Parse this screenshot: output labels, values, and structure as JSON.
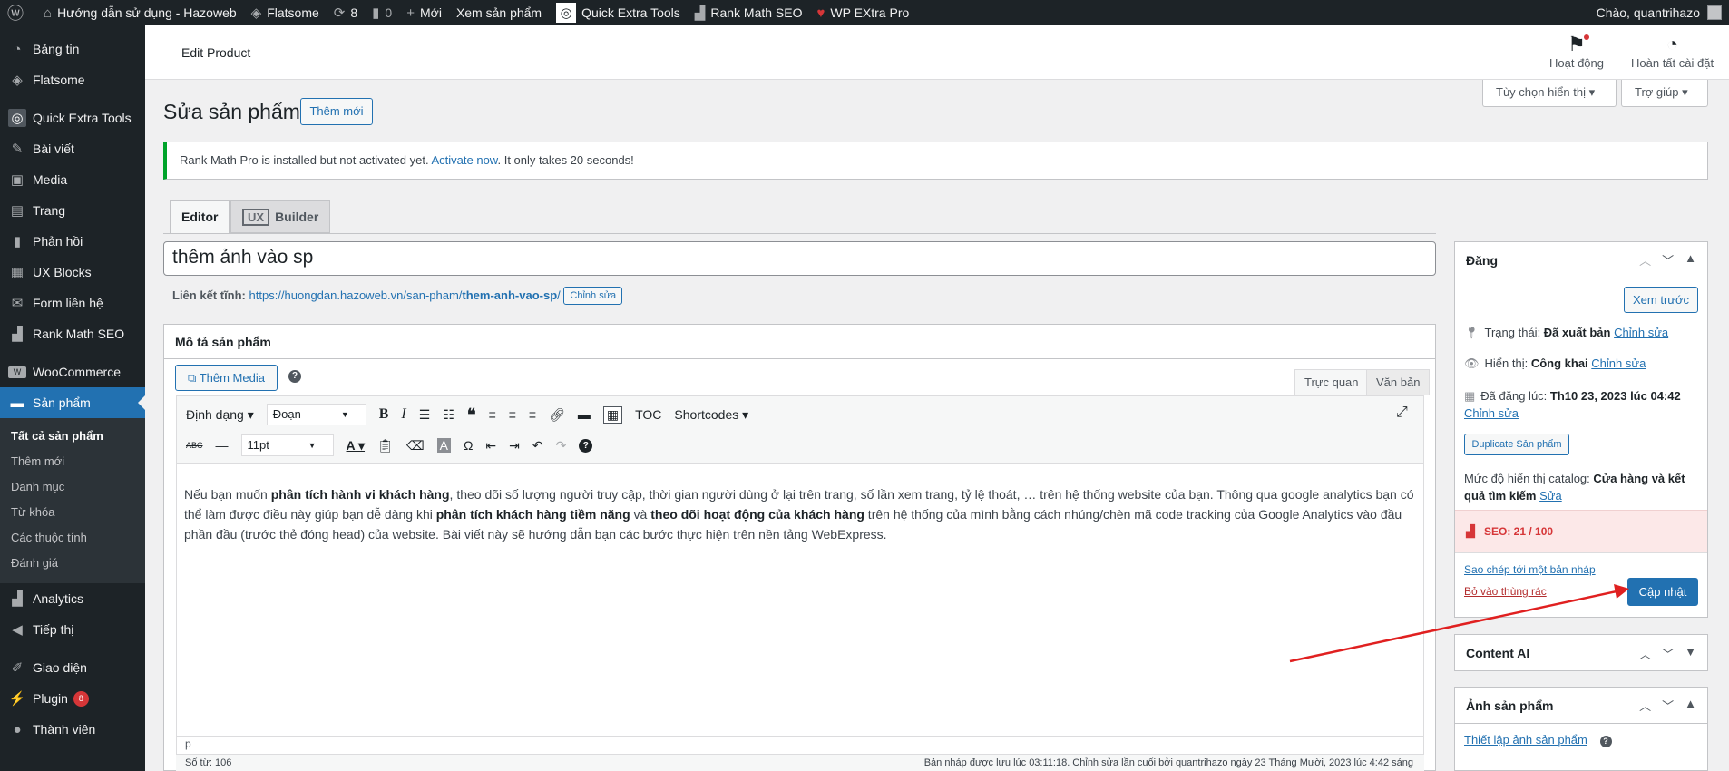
{
  "adminbar": {
    "site_name": "Hướng dẫn sử dụng - Hazoweb",
    "flatsome": "Flatsome",
    "updates": "8",
    "comments": "0",
    "new": "Mới",
    "view_product": "Xem sản phẩm",
    "quick_extra_tools": "Quick Extra Tools",
    "rank_math": "Rank Math SEO",
    "wp_extra": "WP EXtra Pro",
    "greeting": "Chào, quantrihazo"
  },
  "sidebar": {
    "items": [
      {
        "label": "Bảng tin",
        "icon": "dashboard-icon"
      },
      {
        "label": "Flatsome",
        "icon": "flatsome-icon"
      },
      {
        "label": "Quick Extra Tools",
        "icon": "quick-extra-tools-icon"
      },
      {
        "label": "Bài viết",
        "icon": "pin-icon"
      },
      {
        "label": "Media",
        "icon": "media-icon"
      },
      {
        "label": "Trang",
        "icon": "page-icon"
      },
      {
        "label": "Phản hồi",
        "icon": "comment-icon"
      },
      {
        "label": "UX Blocks",
        "icon": "blocks-icon"
      },
      {
        "label": "Form liên hệ",
        "icon": "mail-icon"
      },
      {
        "label": "Rank Math SEO",
        "icon": "rank-math-icon"
      },
      {
        "label": "WooCommerce",
        "icon": "woocommerce-icon"
      },
      {
        "label": "Sản phẩm",
        "icon": "product-icon"
      },
      {
        "label": "Analytics",
        "icon": "analytics-icon"
      },
      {
        "label": "Tiếp thị",
        "icon": "megaphone-icon"
      },
      {
        "label": "Giao diện",
        "icon": "brush-icon"
      },
      {
        "label": "Plugin",
        "icon": "plugin-icon",
        "badge": "8"
      },
      {
        "label": "Thành viên",
        "icon": "user-icon"
      }
    ],
    "submenu": [
      "Tất cả sản phẩm",
      "Thêm mới",
      "Danh mục",
      "Từ khóa",
      "Các thuộc tính",
      "Đánh giá"
    ]
  },
  "header": {
    "title": "Edit Product",
    "activity": "Hoạt động",
    "setup": "Hoàn tất cài đặt",
    "screen_options": "Tùy chọn hiển thị ▾",
    "help": "Trợ giúp ▾"
  },
  "page": {
    "heading": "Sửa sản phẩm",
    "add_new": "Thêm mới",
    "notice_prefix": "Rank Math Pro is installed but not activated yet. ",
    "notice_link": "Activate now",
    "notice_suffix": ". It only takes 20 seconds!",
    "tab_editor": "Editor",
    "tab_ux": "UX",
    "tab_builder": "Builder",
    "product_title": "thêm ảnh vào sp",
    "permalink_label": "Liên kết tĩnh:",
    "permalink_base": "https://huongdan.hazoweb.vn/san-pham/",
    "permalink_slug": "them-anh-vao-sp",
    "permalink_end": "/",
    "permalink_edit": "Chỉnh sửa"
  },
  "editor": {
    "box_title": "Mô tả sản phẩm",
    "add_media": "Thêm Media",
    "tab_visual": "Trực quan",
    "tab_text": "Văn bản",
    "format_menu": "Định dạng ▾",
    "paragraph": "Đoạn",
    "font_size": "11pt",
    "toc": "TOC",
    "shortcodes": "Shortcodes ▾",
    "content_parts": [
      {
        "t": "Nếu bạn muốn ",
        "b": false
      },
      {
        "t": "phân tích hành vi khách hàng",
        "b": true
      },
      {
        "t": ", theo dõi số lượng người truy cập, thời gian người dùng ở lại trên trang, số lần xem trang, tỷ lệ thoát, … trên hệ thống website của bạn. Thông qua google analytics bạn có thể làm được điều này giúp bạn dễ dàng khi ",
        "b": false
      },
      {
        "t": "phân tích khách hàng tiềm năng",
        "b": true
      },
      {
        "t": " và ",
        "b": false
      },
      {
        "t": "theo dõi hoạt động của khách hàng",
        "b": true
      },
      {
        "t": " trên hệ thống của mình bằng cách nhúng/chèn mã code tracking của Google Analytics vào đầu phần đầu (trước thẻ đóng head) của website. Bài viết này sẽ hướng dẫn bạn các bước thực hiện trên nền tảng WebExpress.",
        "b": false
      }
    ],
    "path": "p",
    "word_count": "Số từ: 106",
    "save_status": "Bản nháp được lưu lúc 03:11:18. Chỉnh sửa lần cuối bởi quantrihazo ngày 23 Tháng Mười, 2023 lúc 4:42 sáng"
  },
  "publish": {
    "title": "Đăng",
    "preview": "Xem trước",
    "status_label": "Trạng thái: ",
    "status_value": "Đã xuất bản",
    "status_edit": "Chỉnh sửa",
    "visibility_label": "Hiển thị: ",
    "visibility_value": "Công khai",
    "visibility_edit": "Chỉnh sửa",
    "published_label": "Đã đăng lúc: ",
    "published_value": "Th10 23, 2023 lúc 04:42",
    "published_edit": "Chỉnh sửa",
    "duplicate": "Duplicate Sản phẩm",
    "catalog_label": "Mức độ hiển thị catalog: ",
    "catalog_value": "Cửa hàng và kết quả tìm kiếm",
    "catalog_edit": "Sửa",
    "seo": "SEO: 21 / 100",
    "copy_draft": "Sao chép tới một bản nháp",
    "trash": "Bỏ vào thùng rác",
    "update": "Cập nhật"
  },
  "content_ai": {
    "title": "Content AI"
  },
  "product_image": {
    "title": "Ảnh sản phẩm",
    "set_image": "Thiết lập ảnh sản phẩm"
  },
  "colors": {
    "accent": "#2271b1",
    "adminbar": "#1d2327",
    "notice": "#00a32a",
    "seo_bg": "#fce8e8",
    "arrow": "#e02020"
  }
}
